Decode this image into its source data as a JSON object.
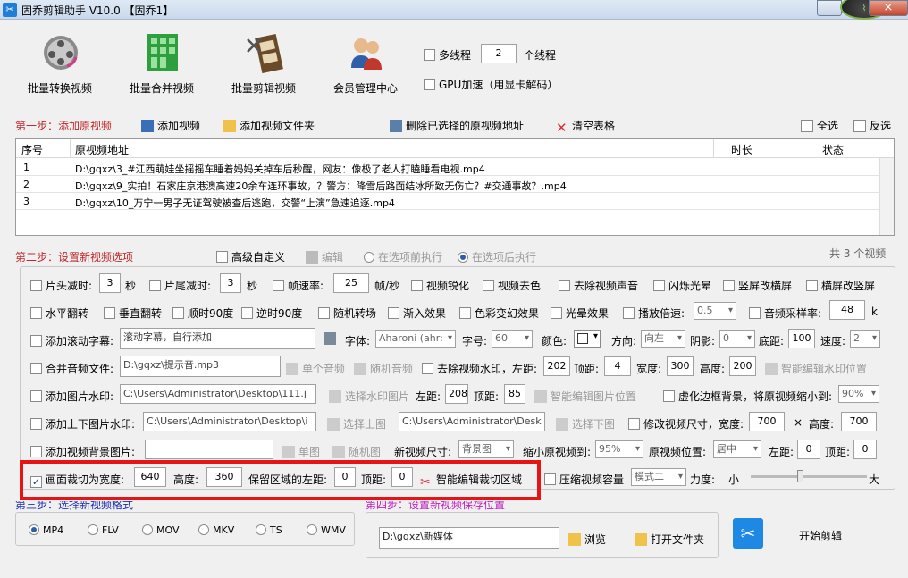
{
  "window": {
    "title": "固乔剪辑助手 V10.0 【固乔1】",
    "close": "×"
  },
  "toolbar": {
    "items": [
      {
        "label": "批量转换视频"
      },
      {
        "label": "批量合并视频"
      },
      {
        "label": "批量剪辑视频"
      },
      {
        "label": "会员管理中心"
      }
    ],
    "multithread_label": "多线程",
    "thread_count": "2",
    "thread_unit": "个线程",
    "gpu_label": "GPU加速（用显卡解码）"
  },
  "step1": {
    "title": "第一步：添加原视频",
    "add_video": "添加视频",
    "add_folder": "添加视频文件夹",
    "delete_selected": "删除已选择的原视频地址",
    "clear_table": "清空表格",
    "select_all": "全选",
    "invert": "反选"
  },
  "table": {
    "headers": [
      "序号",
      "原视频地址",
      "时长",
      "状态"
    ],
    "rows": [
      {
        "num": "1",
        "path": "D:\\gqxz\\3_#江西萌娃坐摇摇车睡着妈妈关掉车后秒醒，网友：像极了老人打瞌睡看电视.mp4"
      },
      {
        "num": "2",
        "path": "D:\\gqxz\\9_实拍！石家庄京港澳高速20余车连环事故，？警方：降雪后路面结冰所致无伤亡？#交通事故？.mp4"
      },
      {
        "num": "3",
        "path": "D:\\gqxz\\10_万宁一男子无证驾驶被查后逃跑，交警“上演”急速追逐.mp4"
      }
    ],
    "total": "共 3 个视频"
  },
  "step2": {
    "title": "第二步：设置新视频选项",
    "advanced": "高级自定义",
    "edit": "编辑",
    "before": "在选项前执行",
    "after": "在选项后执行",
    "r1": {
      "head_cut": "片头减时:",
      "head_val": "3",
      "sec1": "秒",
      "tail_cut": "片尾减时:",
      "tail_val": "3",
      "sec2": "秒",
      "fps_label": "帧速率:",
      "fps_val": "25",
      "fps_unit": "帧/秒",
      "sharpen": "视频锐化",
      "desaturate": "视频去色",
      "mute": "去除视频声音",
      "flash": "闪烁光晕",
      "v2h": "竖屏改横屏",
      "h2v": "横屏改竖屏"
    },
    "r2": {
      "hflip": "水平翻转",
      "vflip": "垂直翻转",
      "cw90": "顺时90度",
      "ccw90": "逆时90度",
      "random_trans": "随机转场",
      "fade_in": "渐入效果",
      "color_fx": "色彩变幻效果",
      "halo": "光晕效果",
      "speed_label": "播放倍速:",
      "speed_val": "0.5",
      "sample_label": "音频采样率:",
      "sample_val": "48",
      "sample_unit": "k"
    },
    "r3": {
      "scroll_label": "添加滚动字幕:",
      "scroll_placeholder": "滚动字幕，自行添加",
      "font_label": "字体:",
      "font_val": "Aharoni (ahr:",
      "size_label": "字号:",
      "size_val": "60",
      "color_label": "颜色:",
      "dir_label": "方向:",
      "dir_val": "向左",
      "shadow_label": "阴影:",
      "shadow_val": "0",
      "bottom_label": "底距:",
      "bottom_val": "100",
      "speed2_label": "速度:",
      "speed2_val": "2"
    },
    "r4": {
      "merge_audio": "合并音频文件:",
      "audio_path": "D:\\gqxz\\提示音.mp3",
      "single_audio": "单个音频",
      "random_audio": "随机音频",
      "remove_wm": "去除视频水印，左距:",
      "wm_left": "202",
      "top_label": "顶距:",
      "wm_top": "4",
      "width_label": "宽度:",
      "wm_width": "300",
      "height_label": "高度:",
      "wm_height": "200",
      "smart_wm": "智能编辑水印位置"
    },
    "r5": {
      "img_wm": "添加图片水印:",
      "img_path": "C:\\Users\\Administrator\\Desktop\\111.j",
      "choose_img": "选择水印图片",
      "left_label": "左距:",
      "img_left": "208",
      "top_label": "顶距:",
      "img_top": "85",
      "smart_img": "智能编辑图片位置",
      "blur_bg": "虚化边框背景，将原视频缩小到:",
      "blur_val": "90%"
    },
    "r6": {
      "tb_img": "添加上下图片水印:",
      "top_path": "C:\\Users\\Administrator\\Desktop\\i",
      "choose_top": "选择上图",
      "bottom_path": "C:\\Users\\Administrator\\Desk",
      "choose_bottom": "选择下图",
      "resize": "修改视频尺寸，宽度:",
      "res_w": "700",
      "times": "×",
      "height_label": "高度:",
      "res_h": "700"
    },
    "r7": {
      "bg_img": "添加视频背景图片:",
      "single": "单图",
      "random": "随机图",
      "newsize_label": "新视频尺寸:",
      "newsize_val": "背景图",
      "shrink_label": "缩小原视频到:",
      "shrink_val": "95%",
      "pos_label": "原视频位置:",
      "pos_val": "居中",
      "left_label": "左距:",
      "pos_left": "0",
      "top_label": "顶距:",
      "pos_top": "0"
    },
    "r8": {
      "crop_label": "画面裁切为宽度:",
      "crop_w": "640",
      "crop_h_label": "高度:",
      "crop_h": "360",
      "keep_left_label": "保留区域的左距:",
      "keep_left": "0",
      "keep_top_label": "顶距:",
      "keep_top": "0",
      "smart_crop": "智能编辑裁切区域",
      "compress": "压缩视频容量",
      "mode_val": "模式二",
      "strength": "力度:",
      "small": "小",
      "big": "大"
    }
  },
  "step3": {
    "title": "第三步：选择新视频格式",
    "formats": [
      "MP4",
      "FLV",
      "MOV",
      "MKV",
      "TS",
      "WMV"
    ]
  },
  "step4": {
    "title": "第四步：设置新视频保存位置",
    "save_path": "D:\\gqxz\\新媒体",
    "browse": "浏览",
    "open_folder": "打开文件夹"
  },
  "start": {
    "label": "开始剪辑"
  },
  "colors": {
    "accent_red": "#c0282a",
    "step_blue": "#1d2fb0",
    "step_magenta": "#c01ec0",
    "highlight": "#e81414"
  }
}
